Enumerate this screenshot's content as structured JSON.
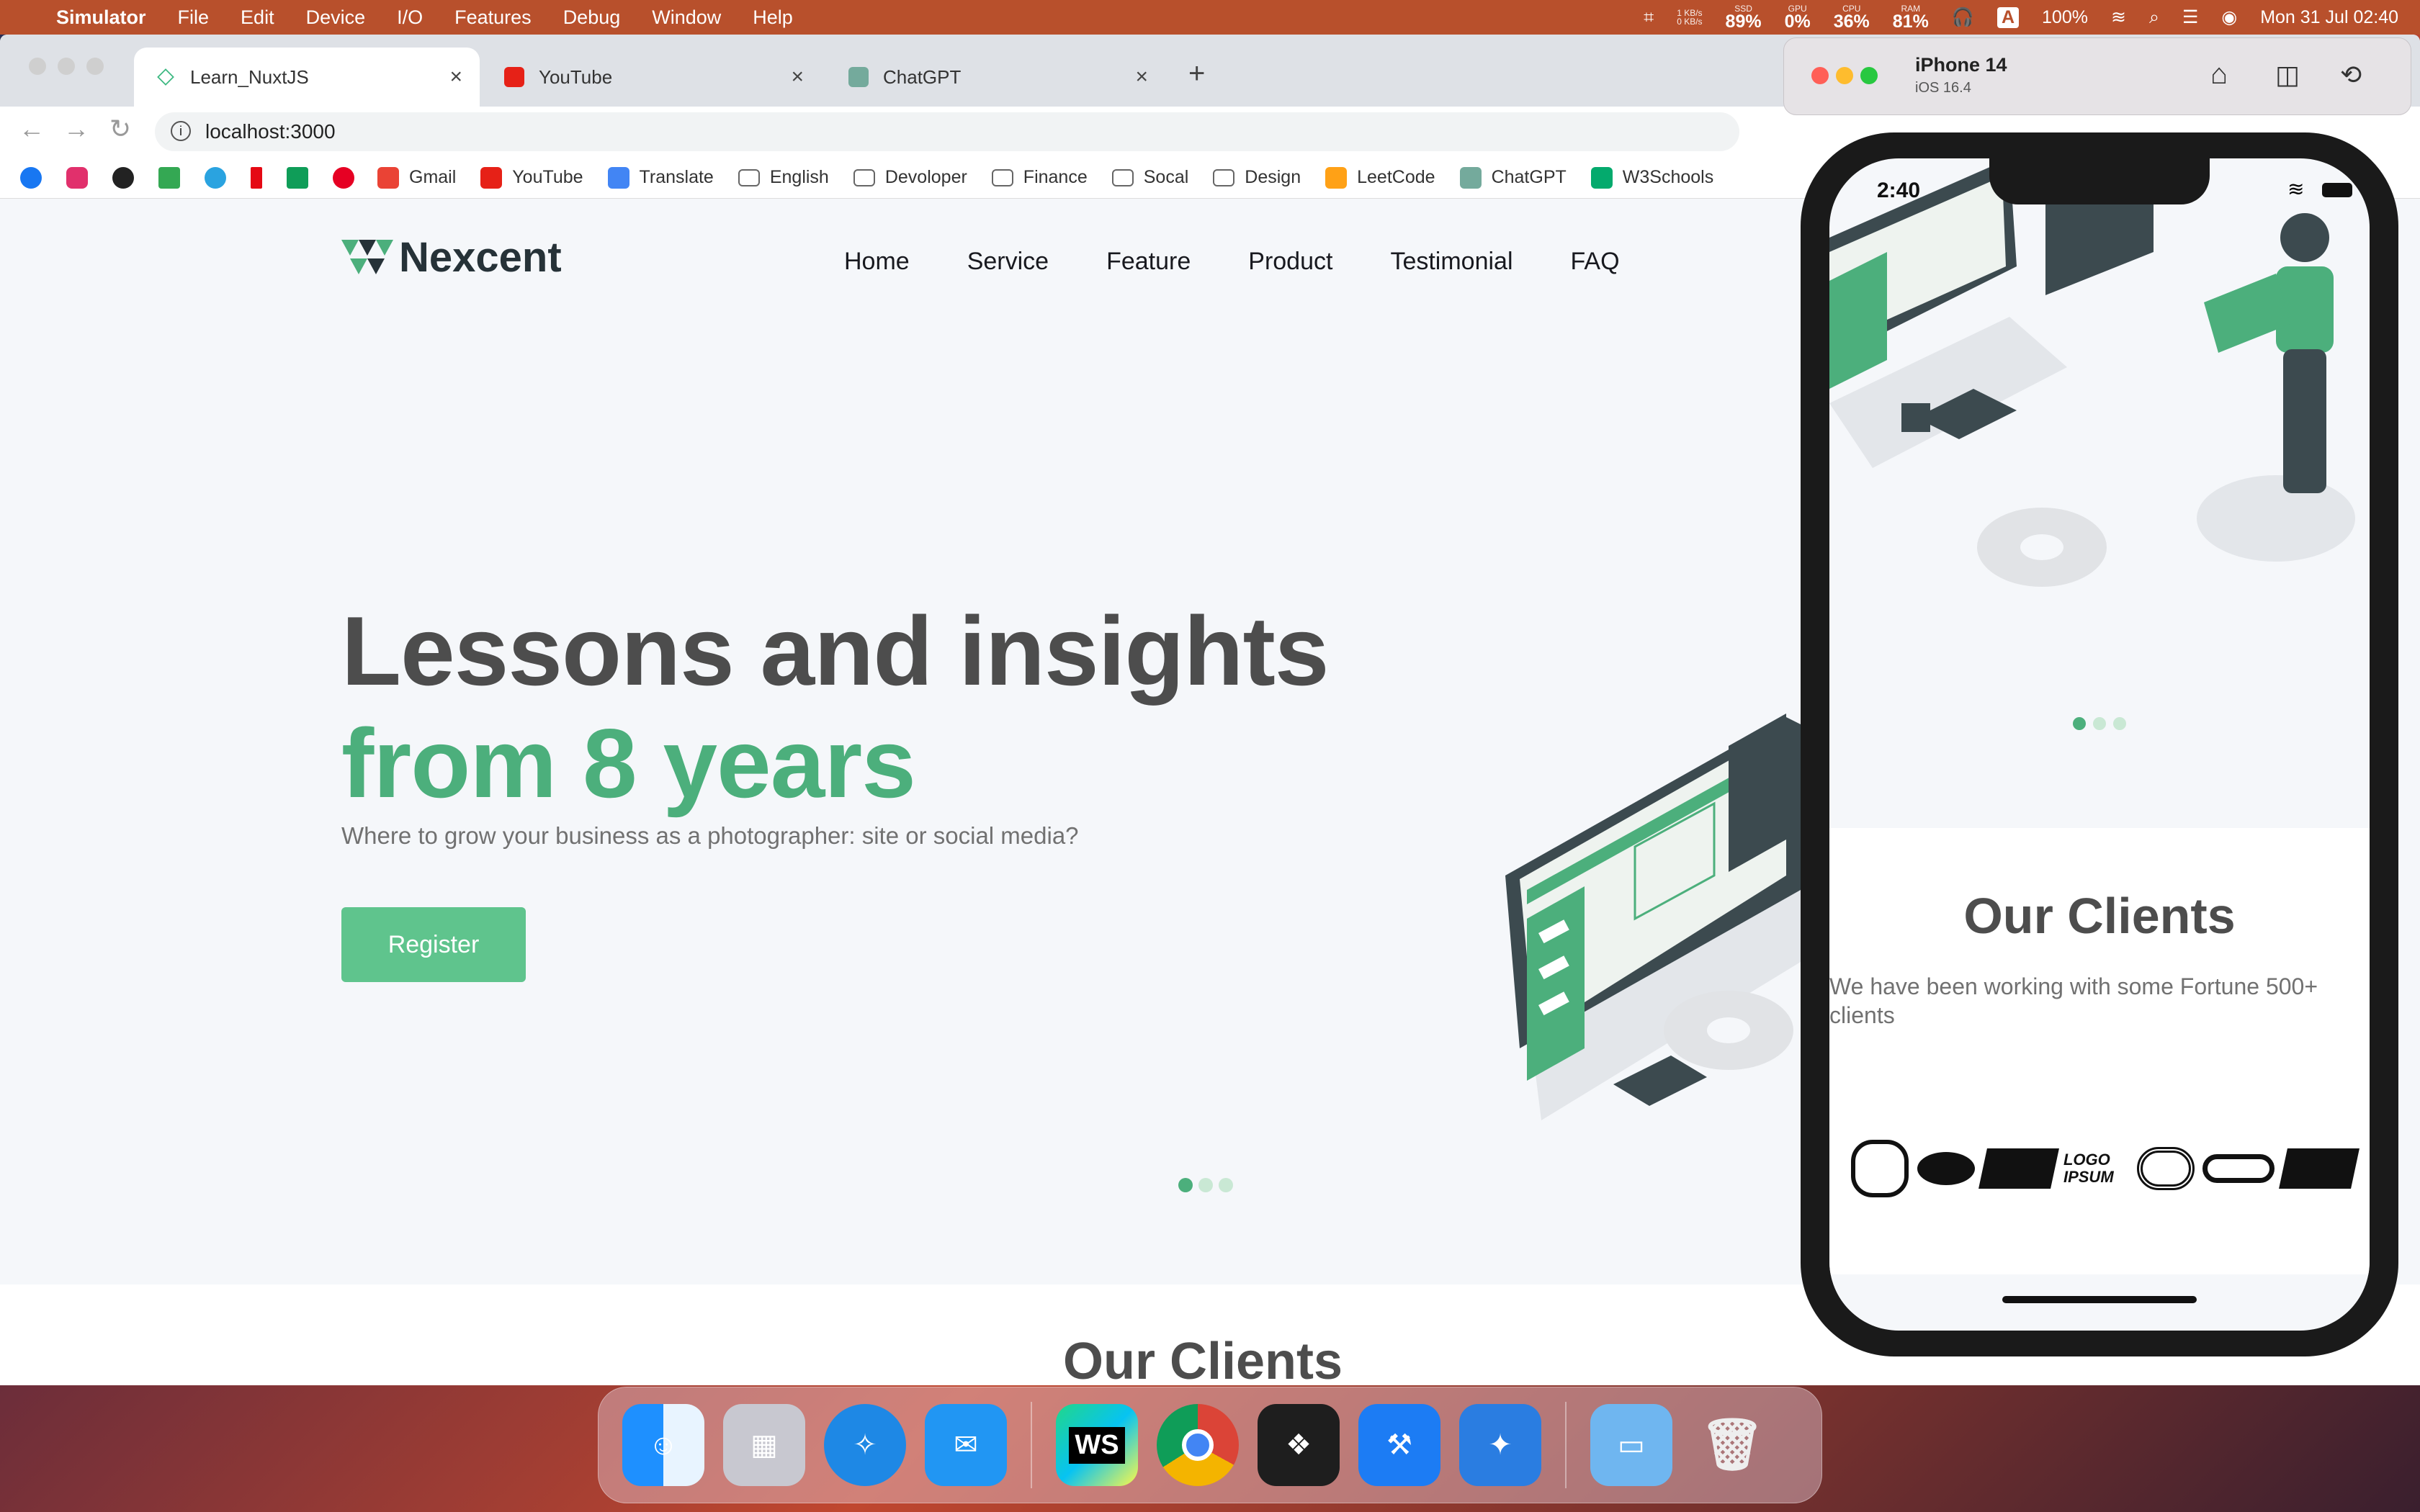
{
  "menubar": {
    "app": "Simulator",
    "items": [
      "File",
      "Edit",
      "Device",
      "I/O",
      "Features",
      "Debug",
      "Window",
      "Help"
    ],
    "stats": [
      {
        "top": "1 KB/s",
        "bottom": "0 KB/s"
      },
      {
        "label": "SSD",
        "value": "89%"
      },
      {
        "label": "GPU",
        "value": "0%"
      },
      {
        "label": "CPU",
        "value": "36%"
      },
      {
        "label": "RAM",
        "value": "81%"
      }
    ],
    "input_source": "A",
    "battery": "100%",
    "datetime": "Mon 31 Jul  02:40"
  },
  "browser": {
    "tabs": [
      {
        "title": "Learn_NuxtJS",
        "active": true
      },
      {
        "title": "YouTube",
        "active": false
      },
      {
        "title": "ChatGPT",
        "active": false
      }
    ],
    "url": "localhost:3000",
    "bookmarks": [
      "Gmail",
      "YouTube",
      "Translate",
      "English",
      "Devoloper",
      "Finance",
      "Socal",
      "Design",
      "LeetCode",
      "ChatGPT",
      "W3Schools"
    ]
  },
  "site": {
    "logo": "Nexcent",
    "nav": [
      "Home",
      "Service",
      "Feature",
      "Product",
      "Testimonial",
      "FAQ"
    ],
    "hero_line1": "Lessons and insights",
    "hero_line2": "from 8 years",
    "hero_sub": "Where to grow your business as a photographer: site or social media?",
    "cta": "Register",
    "clients_title": "Our Clients",
    "carousel_active": 1
  },
  "simulator": {
    "device": "iPhone 14",
    "os": "iOS 16.4",
    "time": "2:40",
    "clients_title": "Our Clients",
    "clients_sub": "We have been working with some Fortune 500+ clients",
    "client_logos": [
      "LOGO IPSUM"
    ]
  },
  "colors": {
    "accent": "#4caf7c",
    "button": "#5fc48d",
    "heading": "#4d4d4d",
    "menubar": "#b8502c"
  }
}
